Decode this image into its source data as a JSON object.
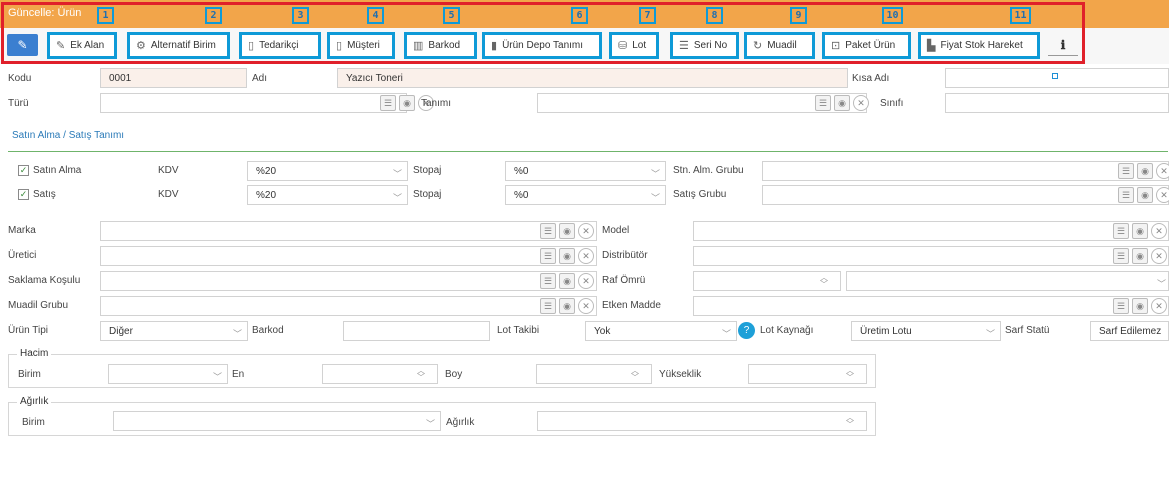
{
  "header": {
    "title": "Güncelle: Ürün",
    "badge_numbers": [
      "1",
      "2",
      "3",
      "4",
      "5",
      "6",
      "7",
      "8",
      "9",
      "10",
      "11"
    ]
  },
  "toolbar": {
    "buttons": [
      {
        "label": "Ek Alan",
        "icon": "paperclip-icon"
      },
      {
        "label": "Alternatif Birim",
        "icon": "cogs-icon"
      },
      {
        "label": "Tedarikçi",
        "icon": "document-icon"
      },
      {
        "label": "Müşteri",
        "icon": "document-icon"
      },
      {
        "label": "Barkod",
        "icon": "barcode-icon"
      },
      {
        "label": "Ürün Depo Tanımı",
        "icon": "warehouse-icon"
      },
      {
        "label": "Lot",
        "icon": "lot-icon"
      },
      {
        "label": "Seri No",
        "icon": "list-icon"
      },
      {
        "label": "Muadil",
        "icon": "refresh-icon"
      },
      {
        "label": "Paket Ürün",
        "icon": "package-icon"
      },
      {
        "label": "Fiyat Stok Hareket",
        "icon": "price-icon"
      }
    ]
  },
  "form": {
    "kodu_label": "Kodu",
    "kodu_value": "0001",
    "adi_label": "Adı",
    "adi_value": "Yazıcı Toneri",
    "kisa_adi_label": "Kısa Adı",
    "turu_label": "Türü",
    "tanimi_label": "Tanımı",
    "sinifi_label": "Sınıfı",
    "section_title": "Satın Alma / Satış Tanımı",
    "satin_alma_label": "Satın Alma",
    "satis_label": "Satış",
    "kdv_label": "KDV",
    "kdv_purchase": "%20",
    "kdv_sale": "%20",
    "stopaj_label": "Stopaj",
    "stopaj_purchase": "%0",
    "stopaj_sale": "%0",
    "stn_alm_grubu_label": "Stn. Alm. Grubu",
    "satis_grubu_label": "Satış Grubu",
    "marka_label": "Marka",
    "model_label": "Model",
    "uretici_label": "Üretici",
    "distributor_label": "Distribütör",
    "saklama_label": "Saklama Koşulu",
    "raf_omru_label": "Raf Ömrü",
    "muadil_grubu_label": "Muadil Grubu",
    "etken_madde_label": "Etken Madde",
    "urun_tipi_label": "Ürün Tipi",
    "urun_tipi_value": "Diğer",
    "barkod_label": "Barkod",
    "lot_takibi_label": "Lot Takibi",
    "lot_takibi_value": "Yok",
    "lot_kaynagi_label": "Lot Kaynağı",
    "lot_kaynagi_value": "Üretim Lotu",
    "sarf_statu_label": "Sarf Statü",
    "sarf_statu_value": "Sarf Edilemez",
    "hacim_legend": "Hacim",
    "hacim_birim_label": "Birim",
    "en_label": "En",
    "boy_label": "Boy",
    "yukseklik_label": "Yükseklik",
    "agirlik_legend": "Ağırlık",
    "agirlik_birim_label": "Birim",
    "agirlik_label": "Ağırlık"
  },
  "colors": {
    "header_orange": "#f2a54a",
    "highlight_blue": "#0e9ad7",
    "frame_red": "#e0202a",
    "section_blue": "#2a7ab8",
    "divider_green": "#6fb46b"
  }
}
